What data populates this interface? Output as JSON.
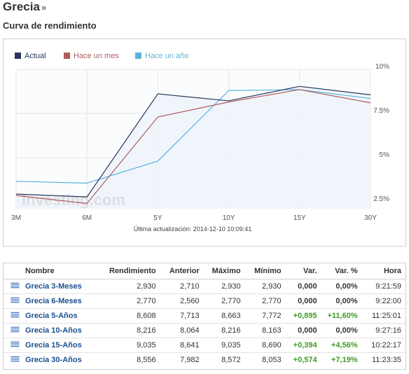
{
  "page": {
    "title": "Grecia",
    "title_suffix": "»",
    "section_title": "Curva de rendimiento"
  },
  "colors": {
    "actual": "#283659",
    "month_ago": "#b15c5c",
    "year_ago": "#5ab4d9",
    "area_fill": "#eef4fc",
    "grid": "#e6e6e6",
    "positive": "#3c9c22",
    "link": "#1a4f8f"
  },
  "chart_data": {
    "type": "line",
    "categories": [
      "3M",
      "6M",
      "5Y",
      "10Y",
      "15Y",
      "30Y"
    ],
    "series": [
      {
        "name": "Actual",
        "values": [
          2.93,
          2.77,
          8.608,
          8.216,
          9.035,
          8.556
        ]
      },
      {
        "name": "Hace un mes",
        "values": [
          2.85,
          2.4,
          7.3,
          8.15,
          8.85,
          8.1
        ]
      },
      {
        "name": "Hace un año",
        "values": [
          3.65,
          3.55,
          4.8,
          8.8,
          8.85,
          8.35
        ]
      }
    ],
    "y_ticks": [
      "10%",
      "7.5%",
      "5%",
      "2.5%"
    ],
    "y_tick_values": [
      10,
      7.5,
      5,
      2.5
    ],
    "ylim": [
      2.1,
      10
    ],
    "grid": true,
    "legend_position": "top-left",
    "footnote": "Última actualización: 2014-12-10 10:09:41",
    "watermark": "Investing.com"
  },
  "table": {
    "headers": {
      "name": "Nombre",
      "yield": "Rendimiento",
      "prev": "Anterior",
      "high": "Máximo",
      "low": "Mínimo",
      "chg": "Var.",
      "chg_pct": "Var. %",
      "time": "Hora"
    },
    "rows": [
      {
        "name": "Grecia 3-Meses",
        "yield": "2,930",
        "prev": "2,710",
        "high": "2,930",
        "low": "2,930",
        "chg": "0,000",
        "chg_pct": "0,00%",
        "time": "9:21:59"
      },
      {
        "name": "Grecia 6-Meses",
        "yield": "2,770",
        "prev": "2,560",
        "high": "2,770",
        "low": "2,770",
        "chg": "0,000",
        "chg_pct": "0,00%",
        "time": "9:22:00"
      },
      {
        "name": "Grecia 5-Años",
        "yield": "8,608",
        "prev": "7,713",
        "high": "8,663",
        "low": "7,772",
        "chg": "+0,895",
        "chg_pct": "+11,60%",
        "time": "11:25:01"
      },
      {
        "name": "Grecia 10-Años",
        "yield": "8,216",
        "prev": "8,064",
        "high": "8,216",
        "low": "8,163",
        "chg": "0,000",
        "chg_pct": "0,00%",
        "time": "9:27:16"
      },
      {
        "name": "Grecia 15-Años",
        "yield": "9,035",
        "prev": "8,641",
        "high": "9,035",
        "low": "8,690",
        "chg": "+0,394",
        "chg_pct": "+4,56%",
        "time": "10:22:17"
      },
      {
        "name": "Grecia 30-Años",
        "yield": "8,556",
        "prev": "7,982",
        "high": "8,572",
        "low": "8,053",
        "chg": "+0,574",
        "chg_pct": "+7,19%",
        "time": "11:23:35"
      }
    ]
  }
}
